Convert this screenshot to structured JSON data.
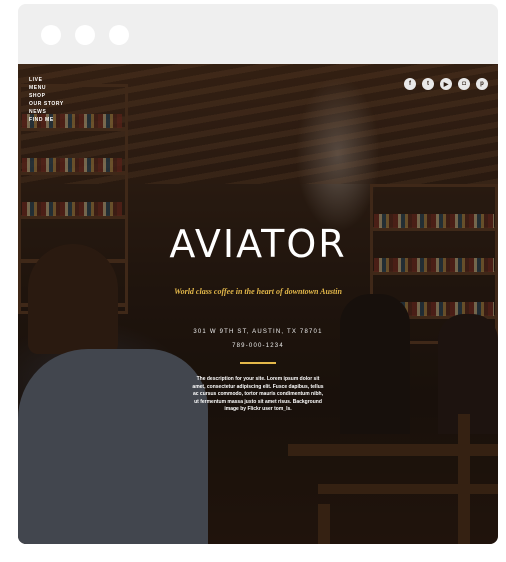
{
  "nav": {
    "items": [
      "LIVE",
      "MENU",
      "SHOP",
      "OUR STORY",
      "NEWS",
      "FIND ME"
    ]
  },
  "social": {
    "icons": [
      "facebook-icon",
      "twitter-icon",
      "youtube-icon",
      "instagram-icon",
      "pinterest-icon"
    ]
  },
  "hero": {
    "title": "AVIATOR",
    "tagline": "World class coffee in the heart of downtown Austin",
    "address": "301 W 9TH ST, AUSTIN, TX 78701",
    "phone": "789-000-1234",
    "description": "The description for your site. Lorem ipsum dolor sit amet, consectetur adipiscing elit. Fusce dapibus, tellus ac cursus commodo, tortor mauris condimentum nibh, ut fermentum massa justo sit amet risus. Background image by Flickr user tom_ls."
  },
  "colors": {
    "accent": "#e4b84a",
    "text": "#ffffff",
    "chrome": "#efefef"
  }
}
